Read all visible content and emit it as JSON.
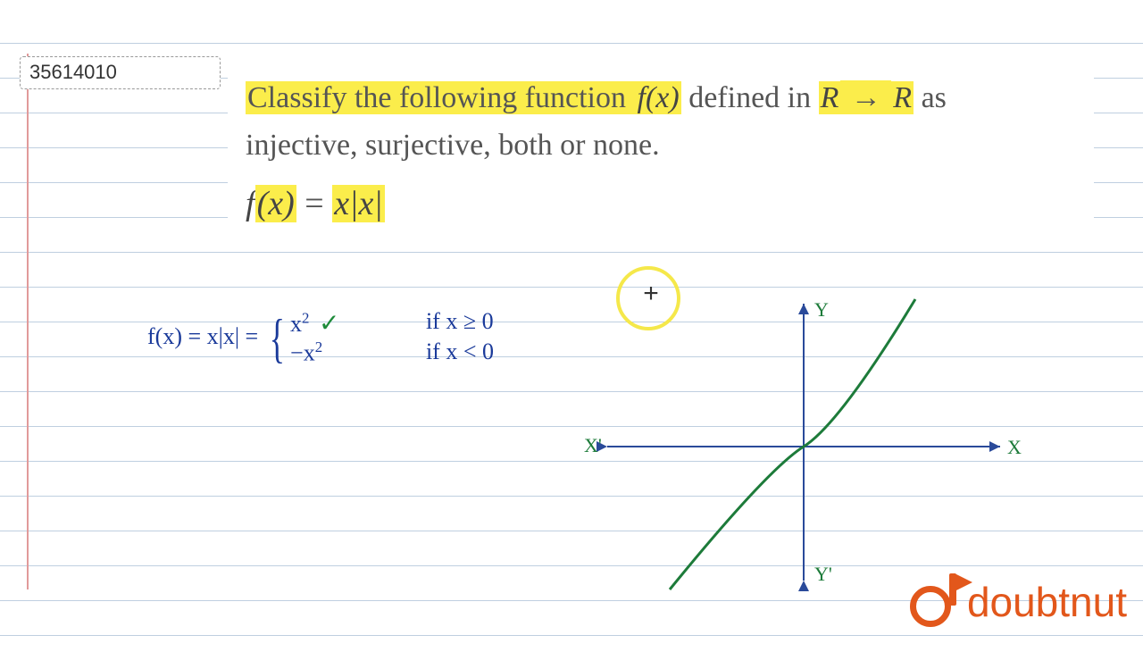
{
  "question_id": "35614010",
  "question": {
    "text_pre": "Classify the following function ",
    "fx": "f(x)",
    "text_mid": " defined in ",
    "domain_R1": "R",
    "arrow": " → ",
    "domain_R2": "R",
    "text_post": " as",
    "line2": "injective, surjective, both or none.",
    "formula_lhs": "f(x)",
    "formula_eq": " = ",
    "formula_rhs": "x|x|"
  },
  "handwriting": {
    "lhs": "f(x) =  x|x|  = ",
    "piece1_base": "x",
    "piece1_exp": "2",
    "piece2_base": "−x",
    "piece2_exp": "2",
    "cond1": "if  x ≥ 0",
    "cond2": "if  x < 0",
    "checkmark": "✓"
  },
  "graph": {
    "axis_x_pos": "X",
    "axis_x_neg": "X'",
    "axis_y_pos": "Y",
    "axis_y_neg": "Y'"
  },
  "cursor_symbol": "+",
  "logo_text": "doubtnut",
  "colors": {
    "highlight": "#fbed4b",
    "ink_blue": "#1a3a9a",
    "curve_green": "#1d7b3a",
    "brand": "#e2571b"
  }
}
